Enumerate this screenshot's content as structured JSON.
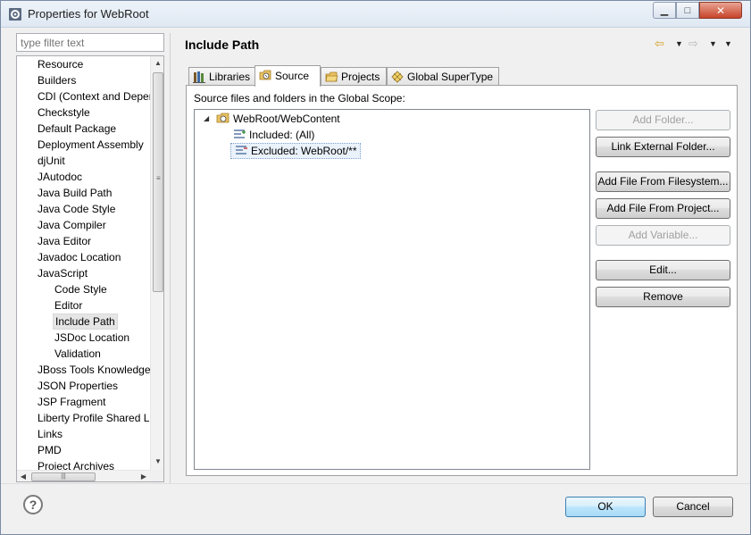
{
  "window": {
    "title": "Properties for WebRoot",
    "min_label": "▭",
    "max_label": "□",
    "close_label": "✕"
  },
  "filter": {
    "placeholder": "type filter text"
  },
  "tree": {
    "items": [
      "Resource",
      "Builders",
      "CDI (Context and Depen",
      "Checkstyle",
      "Default Package",
      "Deployment Assembly",
      "djUnit",
      "JAutodoc",
      "Java Build Path",
      "Java Code Style",
      "Java Compiler",
      "Java Editor",
      "Javadoc Location",
      "JavaScript",
      "Code Style",
      "Editor",
      "Include Path",
      "JSDoc Location",
      "Validation",
      "JBoss Tools Knowledge",
      "JSON Properties",
      "JSP Fragment",
      "Liberty Profile Shared Li",
      "Links",
      "PMD",
      "Project Archives"
    ],
    "selected": "Include Path"
  },
  "page": {
    "title": "Include Path"
  },
  "tabs": [
    "Libraries",
    "Source",
    "Projects",
    "Global SuperType"
  ],
  "active_tab": "Source",
  "scope_label": "Source files and folders in the Global Scope:",
  "source_tree": {
    "root": "WebRoot/WebContent",
    "included": "Included: (All)",
    "excluded": "Excluded: WebRoot/**"
  },
  "buttons": {
    "add_folder": "Add Folder...",
    "link_external": "Link External Folder...",
    "add_file_fs": "Add File From Filesystem...",
    "add_file_project": "Add File From Project...",
    "add_variable": "Add Variable...",
    "edit": "Edit...",
    "remove": "Remove"
  },
  "dialog": {
    "help": "?",
    "ok": "OK",
    "cancel": "Cancel"
  },
  "colors": {
    "accent": "#3c7fb1",
    "nav_arrow": "#d79e1e",
    "close_button": "#c7432a"
  }
}
